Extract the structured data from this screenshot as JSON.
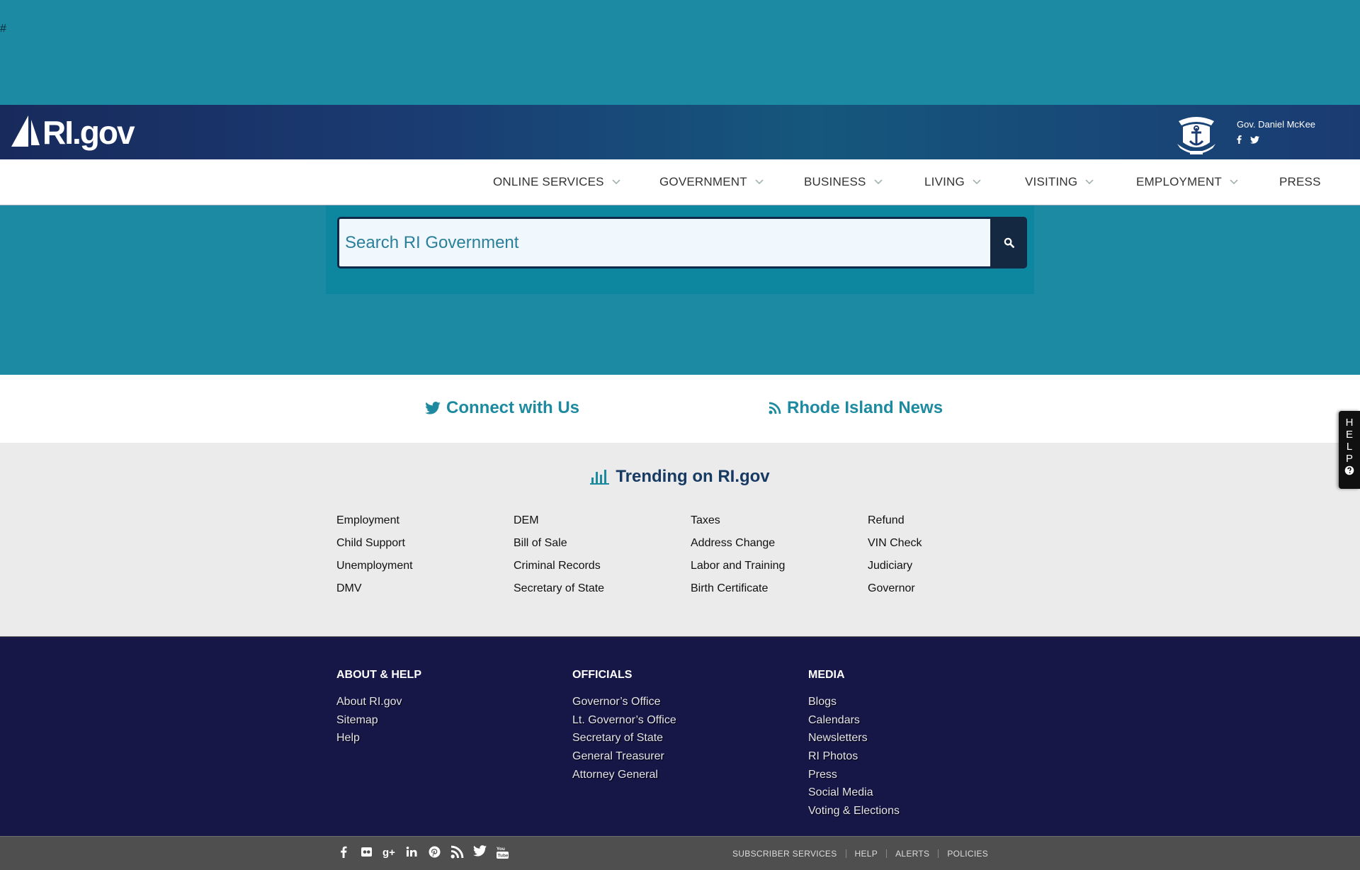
{
  "hash": "#",
  "header": {
    "logo_text": "RI.gov",
    "governor": "Gov. Daniel McKee",
    "governor_social": [
      "f",
      "twitter"
    ]
  },
  "nav": {
    "items": [
      {
        "label": "ONLINE SERVICES",
        "has_dropdown": true
      },
      {
        "label": "GOVERNMENT",
        "has_dropdown": true
      },
      {
        "label": "BUSINESS",
        "has_dropdown": true
      },
      {
        "label": "LIVING",
        "has_dropdown": true
      },
      {
        "label": "VISITING",
        "has_dropdown": true
      },
      {
        "label": "EMPLOYMENT",
        "has_dropdown": true
      },
      {
        "label": "PRESS",
        "has_dropdown": false
      }
    ]
  },
  "search": {
    "placeholder": "Search RI Government",
    "button_icon": "search-icon"
  },
  "connect": {
    "twitter_label": "Connect with Us",
    "news_label": "Rhode Island News"
  },
  "trending": {
    "title": "Trending on RI.gov",
    "columns": [
      [
        "Employment",
        "Child Support",
        "Unemployment",
        "DMV"
      ],
      [
        "DEM",
        "Bill of Sale",
        "Criminal Records",
        "Secretary of State"
      ],
      [
        "Taxes",
        "Address Change",
        "Labor and Training",
        "Birth Certificate"
      ],
      [
        "Refund",
        "VIN Check",
        "Judiciary",
        "Governor"
      ]
    ]
  },
  "footer": {
    "about": {
      "heading": "ABOUT & HELP",
      "links": [
        "About RI.gov",
        "Sitemap",
        "Help"
      ]
    },
    "officials": {
      "heading": "OFFICIALS",
      "links": [
        "Governor’s Office",
        "Lt. Governor’s Office",
        "Secretary of State",
        "General Treasurer",
        "Attorney General"
      ]
    },
    "media": {
      "heading": "MEDIA",
      "links": [
        "Blogs",
        "Calendars",
        "Newsletters",
        "RI Photos",
        "Press",
        "Social Media",
        "Voting & Elections"
      ]
    }
  },
  "bottom": {
    "social_icons": [
      "facebook-icon",
      "flickr-icon",
      "google-plus-icon",
      "linkedin-icon",
      "pinterest-icon",
      "rss-icon",
      "twitter-icon",
      "youtube-icon"
    ],
    "utility_links": [
      "SUBSCRIBER SERVICES",
      "HELP",
      "ALERTS",
      "POLICIES"
    ]
  },
  "help_tab": {
    "letters": [
      "H",
      "E",
      "L",
      "P"
    ]
  },
  "colors": {
    "teal_bg": "#1c8aa3",
    "navy_footer": "#161647",
    "link_teal": "#1d8aa0",
    "trend_title": "#173a63"
  }
}
